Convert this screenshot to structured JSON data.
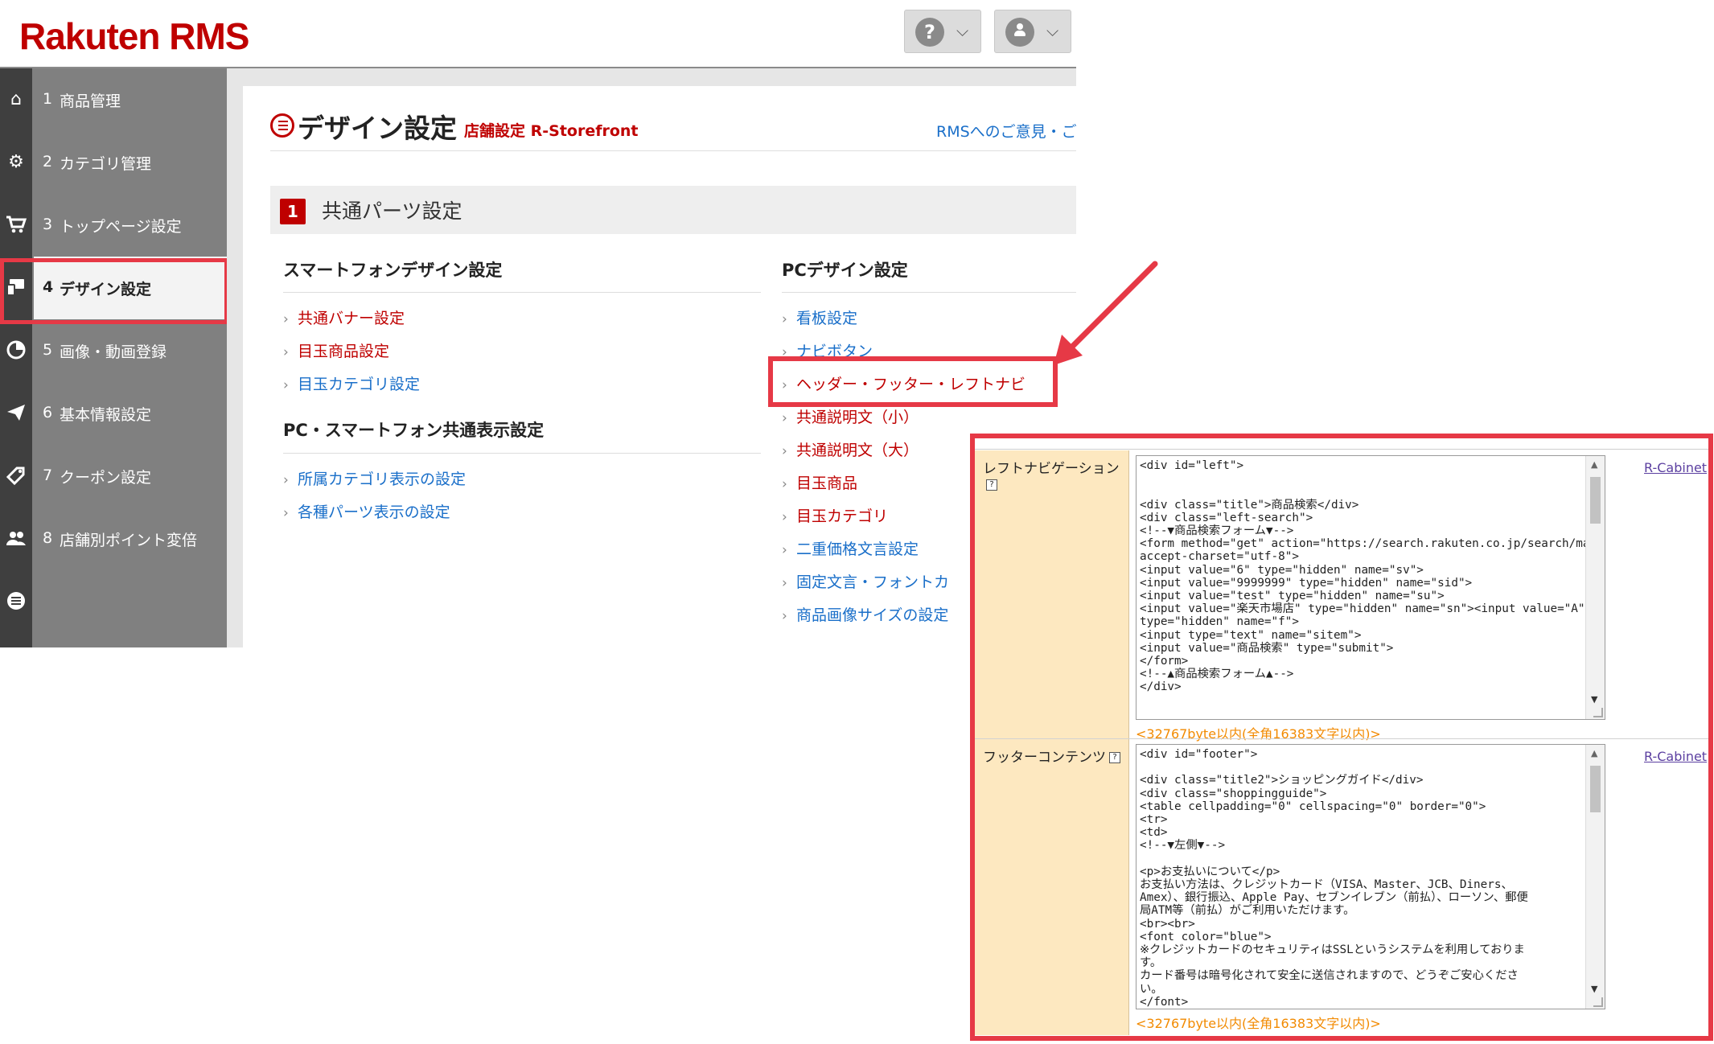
{
  "header": {
    "logo_text": "Rakuten RMS",
    "help_icon_glyph": "?",
    "chevron_glyph": "⌄"
  },
  "sidebar": {
    "items": [
      {
        "num": "1",
        "label": "商品管理",
        "icon": "home-icon"
      },
      {
        "num": "2",
        "label": "カテゴリ管理",
        "icon": "gear-icon"
      },
      {
        "num": "3",
        "label": "トップページ設定",
        "icon": "cart-icon"
      },
      {
        "num": "4",
        "label": "デザイン設定",
        "icon": "design-icon",
        "active": true
      },
      {
        "num": "5",
        "label": "画像・動画登録",
        "icon": "pie-chart-icon"
      },
      {
        "num": "6",
        "label": "基本情報設定",
        "icon": "paper-plane-icon"
      },
      {
        "num": "7",
        "label": "クーポン設定",
        "icon": "coupon-icon"
      },
      {
        "num": "8",
        "label": "店舗別ポイント変倍",
        "icon": "users-icon"
      },
      {
        "num": "",
        "label": "",
        "icon": "list-icon"
      }
    ]
  },
  "page": {
    "title": "デザイン設定",
    "subtitle": "店舗設定 R-Storefront",
    "feedback_link": "RMSへのご意見・ご"
  },
  "section": {
    "number": "1",
    "title": "共通パーツ設定"
  },
  "smartphone": {
    "heading": "スマートフォンデザイン設定",
    "links": [
      "共通バナー設定",
      "目玉商品設定",
      "目玉カテゴリ設定"
    ]
  },
  "common_display": {
    "heading": "PC・スマートフォン共通表示設定",
    "links": [
      "所属カテゴリ表示の設定",
      "各種パーツ表示の設定"
    ]
  },
  "pc": {
    "heading": "PCデザイン設定",
    "links": [
      "看板設定",
      "ナビボタン",
      "ヘッダー・フッター・レフトナビ",
      "共通説明文（小）",
      "共通説明文（大）",
      "目玉商品",
      "目玉カテゴリ",
      "二重価格文言設定",
      "固定文言・フォントカ",
      "商品画像サイズの設定"
    ]
  },
  "overlay": {
    "left_nav": {
      "label": "レフトナビゲーション",
      "code": "<div id=\"left\">\n\n\n<div class=\"title\">商品検索</div>\n<div class=\"left-search\">\n<!--▼商品検索フォーム▼-->\n<form method=\"get\" action=\"https://search.rakuten.co.jp/search/mall\"\naccept-charset=\"utf-8\">\n<input value=\"6\" type=\"hidden\" name=\"sv\">\n<input value=\"9999999\" type=\"hidden\" name=\"sid\">\n<input value=\"test\" type=\"hidden\" name=\"su\">\n<input value=\"楽天市場店\" type=\"hidden\" name=\"sn\"><input value=\"A\"\ntype=\"hidden\" name=\"f\">\n<input type=\"text\" name=\"sitem\">\n<input value=\"商品検索\" type=\"submit\">\n</form>\n<!--▲商品検索フォーム▲-->\n</div>",
      "limit": "<32767byte以内(全角16383文字以内)>",
      "cabinet_link": "R-Cabinet"
    },
    "footer": {
      "label": "フッターコンテンツ",
      "code": "<div id=\"footer\">\n\n<div class=\"title2\">ショッピングガイド</div>\n<div class=\"shoppingguide\">\n<table cellpadding=\"0\" cellspacing=\"0\" border=\"0\">\n<tr>\n<td>\n<!--▼左側▼-->\n\n<p>お支払いについて</p>\nお支払い方法は、クレジットカード（VISA、Master、JCB、Diners、\nAmex）、銀行振込、Apple Pay、セブンイレブン（前払）、ローソン、郵便\n局ATM等（前払）がご利用いただけます。\n<br><br>\n<font color=\"blue\">\n※クレジットカードのセキュリティはSSLというシステムを利用しておりま\nす。\nカード番号は暗号化されて安全に送信されますので、どうぞご安心くださ\nい。\n</font>",
      "limit": "<32767byte以内(全角16383文字以内)>",
      "cabinet_link": "R-Cabinet"
    },
    "help_glyph": "?"
  },
  "colors": {
    "brand_red": "#bf0000",
    "highlight_red": "#e63946",
    "link_blue": "#1a6fc9",
    "label_bg": "#fde8c0",
    "limit_orange": "#f28a00"
  }
}
